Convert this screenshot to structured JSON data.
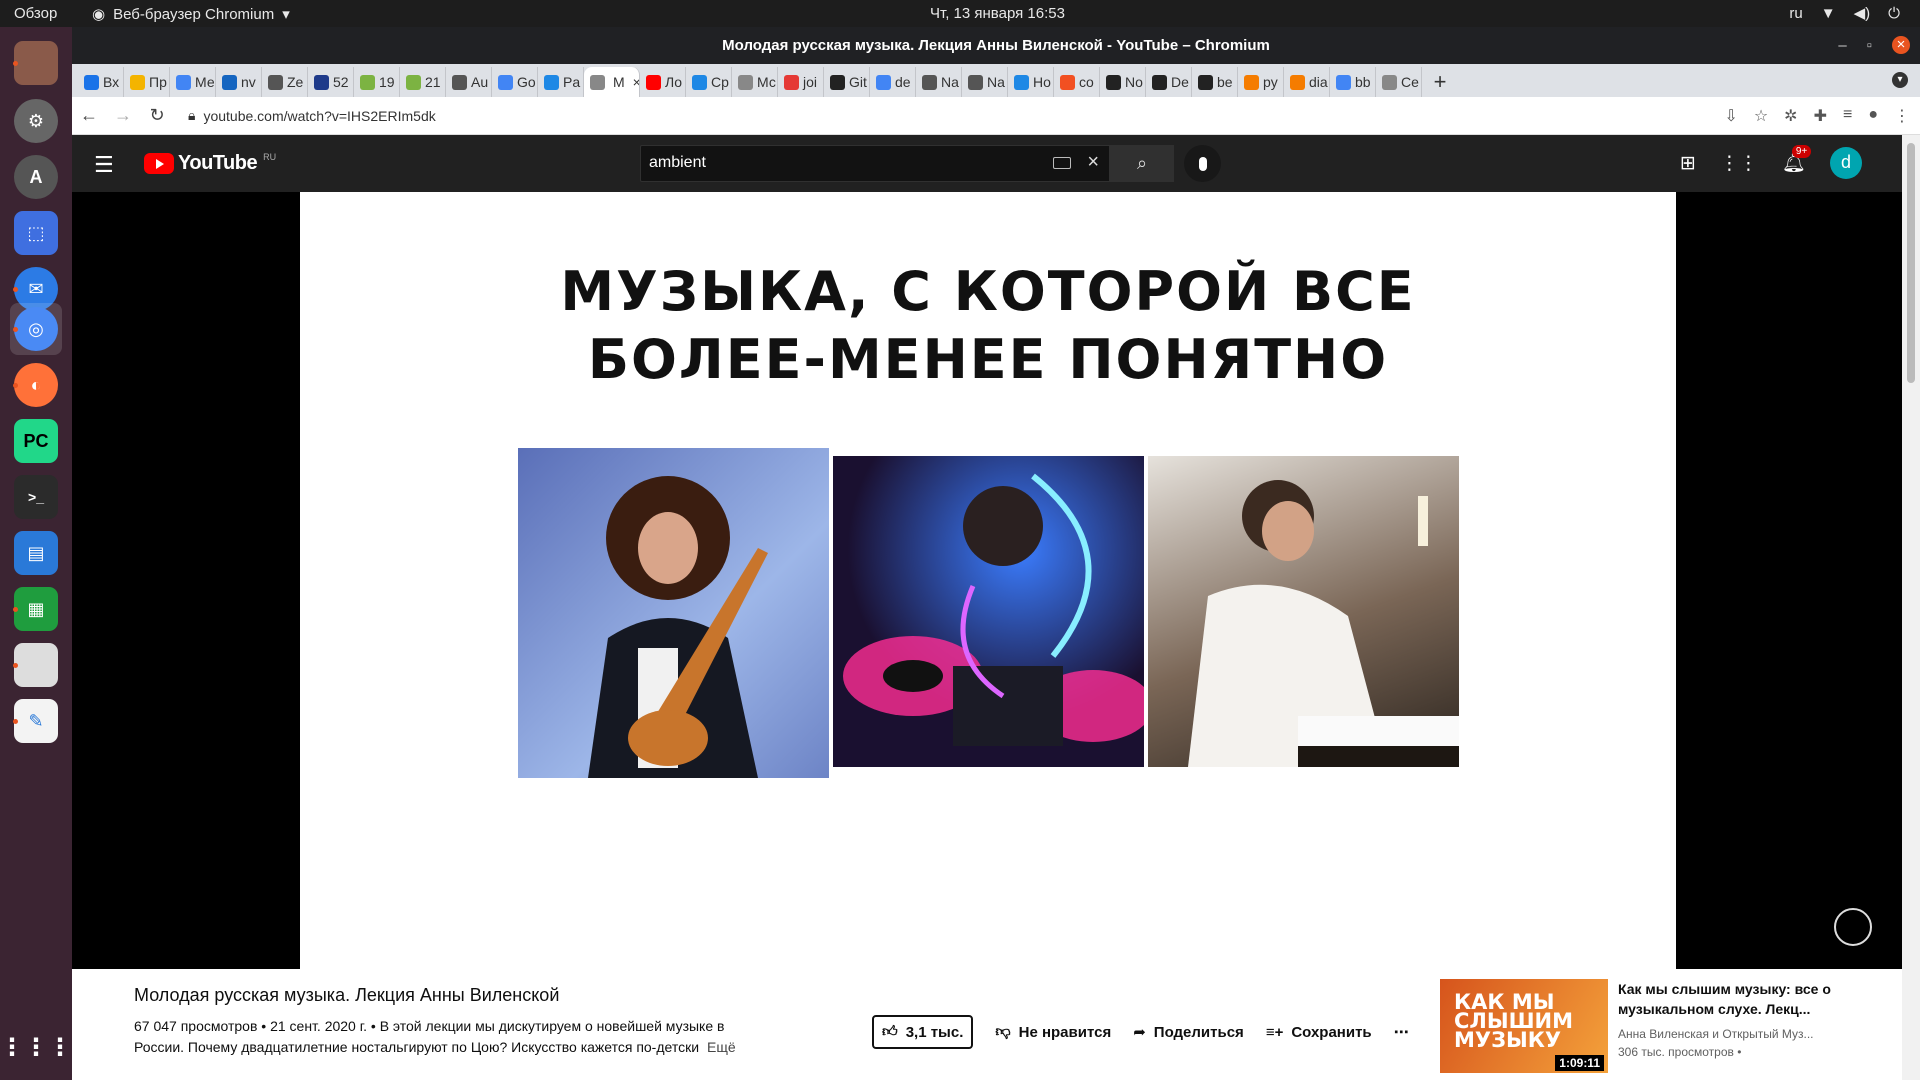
{
  "system": {
    "activities": "Обзор",
    "app_name": "Веб-браузер Chromium",
    "clock": "Чт, 13 января  16:53",
    "lang": "ru"
  },
  "browser": {
    "window_title": "Молодая русская музыка. Лекция Анны Виленской - YouTube – Chromium",
    "url": "youtube.com/watch?v=IHS2ERIm5dk",
    "tabs": [
      {
        "label": "Вх",
        "color": "#1a73e8"
      },
      {
        "label": "Пр",
        "color": "#f4b400"
      },
      {
        "label": "Ме",
        "color": "#4285f4"
      },
      {
        "label": "nv",
        "color": "#1565c0"
      },
      {
        "label": "Ze",
        "color": "#555"
      },
      {
        "label": "52",
        "color": "#1e3a8a"
      },
      {
        "label": "19",
        "color": "#7cb342"
      },
      {
        "label": "21",
        "color": "#7cb342"
      },
      {
        "label": "Au",
        "color": "#555"
      },
      {
        "label": "Go",
        "color": "#4285f4"
      },
      {
        "label": "Pa",
        "color": "#1e88e5"
      },
      {
        "label": "М",
        "color": "#888",
        "active": true
      },
      {
        "label": "Ло",
        "color": "#ff0000"
      },
      {
        "label": "Ср",
        "color": "#1e88e5"
      },
      {
        "label": "Мс",
        "color": "#888"
      },
      {
        "label": "joi",
        "color": "#e53935"
      },
      {
        "label": "Git",
        "color": "#222"
      },
      {
        "label": "de",
        "color": "#4285f4"
      },
      {
        "label": "Na",
        "color": "#555"
      },
      {
        "label": "Na",
        "color": "#555"
      },
      {
        "label": "Но",
        "color": "#1e88e5"
      },
      {
        "label": "co",
        "color": "#f25022"
      },
      {
        "label": "No",
        "color": "#222"
      },
      {
        "label": "De",
        "color": "#222"
      },
      {
        "label": "be",
        "color": "#222"
      },
      {
        "label": "py",
        "color": "#f57c00"
      },
      {
        "label": "dia",
        "color": "#f57c00"
      },
      {
        "label": "bb",
        "color": "#4285f4"
      },
      {
        "label": "Се",
        "color": "#888"
      }
    ]
  },
  "youtube": {
    "region": "RU",
    "logo_text": "YouTube",
    "search_value": "ambient",
    "notifications": "9+",
    "avatar_letter": "d",
    "video": {
      "headline_line1": "МУЗЫКА, С КОТОРОЙ ВСЕ",
      "headline_line2": "БОЛЕЕ-МЕНЕЕ ПОНЯТНО",
      "title": "Молодая русская музыка. Лекция Анны Виленской",
      "desc_line1": "67 047 просмотров • 21 сент. 2020 г. • В этой лекции мы дискутируем о новейшей музыке в",
      "desc_line2": "России. Почему двадцатилетние ностальгируют по Цою? Искусство кажется по-детски",
      "more": "Ещё",
      "likes": "3,1 тыс.",
      "dislike": "Не нравится",
      "share": "Поделиться",
      "save": "Сохранить"
    },
    "recommendation": {
      "thumb_text": "КАК МЫ СЛЫШИМ МУЗЫКУ",
      "duration": "1:09:11",
      "title": "Как мы слышим музыку: все о музыкальном слухе. Лекц...",
      "channel": "Анна Виленская и Открытый Муз...",
      "views": "306 тыс. просмотров •"
    }
  }
}
